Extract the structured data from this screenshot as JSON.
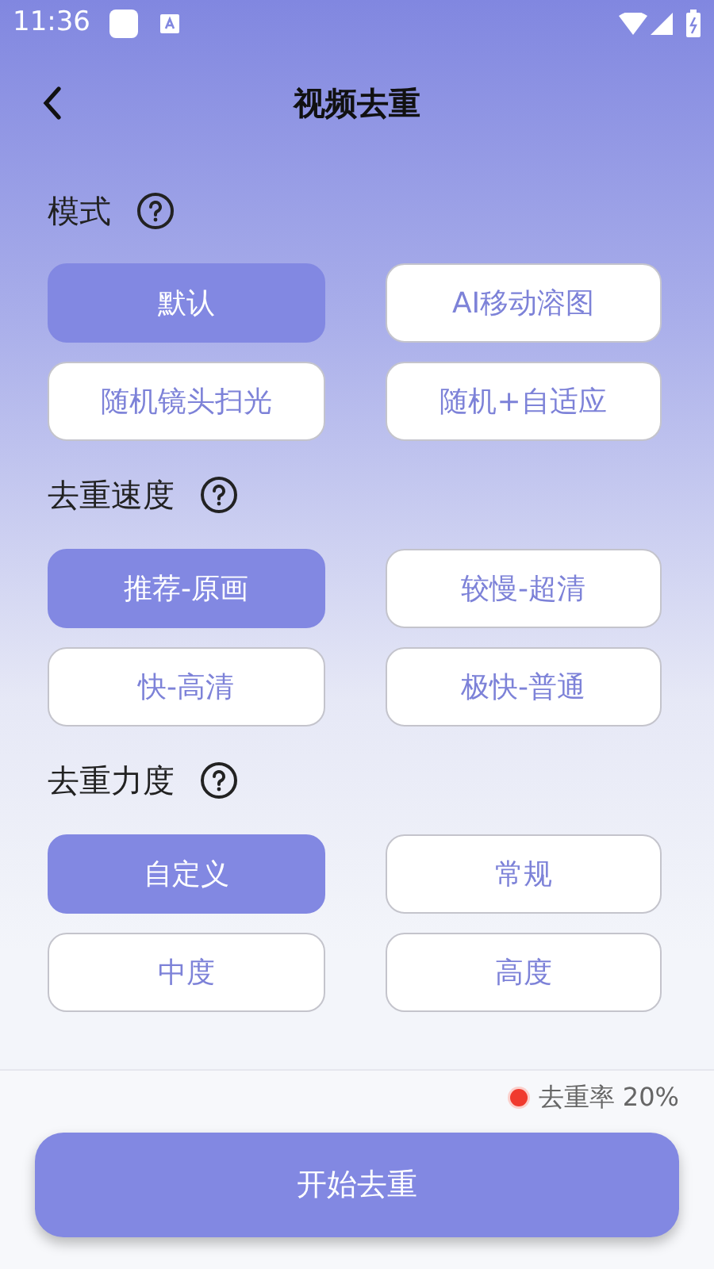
{
  "status_bar": {
    "time": "11:36"
  },
  "header": {
    "title": "视频去重"
  },
  "sections": [
    {
      "title": "模式",
      "options": [
        {
          "label": "默认",
          "selected": true
        },
        {
          "label": "AI移动溶图",
          "selected": false
        },
        {
          "label": "随机镜头扫光",
          "selected": false
        },
        {
          "label": "随机+自适应",
          "selected": false
        }
      ]
    },
    {
      "title": "去重速度",
      "options": [
        {
          "label": "推荐-原画",
          "selected": true
        },
        {
          "label": "较慢-超清",
          "selected": false
        },
        {
          "label": "快-高清",
          "selected": false
        },
        {
          "label": "极快-普通",
          "selected": false
        }
      ]
    },
    {
      "title": "去重力度",
      "options": [
        {
          "label": "自定义",
          "selected": true
        },
        {
          "label": "常规",
          "selected": false
        },
        {
          "label": "中度",
          "selected": false
        },
        {
          "label": "高度",
          "selected": false
        }
      ]
    }
  ],
  "footer": {
    "rate": "去重率 20%",
    "start_button": "开始去重"
  }
}
